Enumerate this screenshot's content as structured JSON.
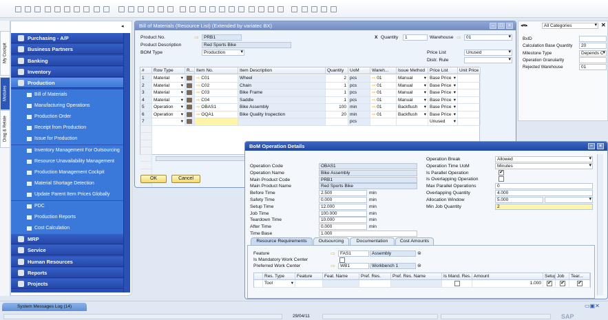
{
  "toolbar": {
    "icons": [
      "new-document",
      "print",
      "print-preview",
      "export-word",
      "export-pdf",
      "export-excel",
      "send-email",
      "send-sms",
      "launch",
      "lock",
      "find",
      "first-record",
      "previous-record",
      "next-record",
      "last-record",
      "last",
      "filter",
      "sort",
      "base-document",
      "target-document",
      "gross-profit",
      "payment-means",
      "journal",
      "template",
      "edit-layout",
      "form-settings",
      "query",
      "alerts",
      "calendar",
      "help",
      "window-tile",
      "window-cascade"
    ]
  },
  "side_tabs": [
    "My Cockpit",
    "Modules",
    "Drag & Relate"
  ],
  "modules": {
    "collapse": "◂",
    "before": [
      {
        "label": "Purchasing - A/P",
        "icon": "cart-icon"
      },
      {
        "label": "Business Partners",
        "icon": "partners-icon"
      },
      {
        "label": "Banking",
        "icon": "banking-icon"
      },
      {
        "label": "Inventory",
        "icon": "inventory-icon"
      }
    ],
    "active": {
      "label": "Production",
      "icon": "gear-icon"
    },
    "sub": [
      {
        "label": "Bill of Materials",
        "icon": "form-icon"
      },
      {
        "label": "Manufacturing Operations",
        "icon": "form-icon"
      },
      {
        "label": "Production Order",
        "icon": "form-icon"
      },
      {
        "label": "Receipt from Production",
        "icon": "form-icon"
      },
      {
        "label": "Issue for Production",
        "icon": "form-icon"
      },
      {
        "label": "Inventory Management For Outsourcing",
        "icon": "form-icon"
      },
      {
        "label": "Resource Unavailability Management",
        "icon": "form-icon"
      },
      {
        "label": "Production Management Cockpit",
        "icon": "form-icon"
      },
      {
        "label": "Material Shortage Detection",
        "icon": "form-icon"
      },
      {
        "label": "Update Parent Item Prices Globally",
        "icon": "form-icon"
      },
      {
        "label": "PDC",
        "icon": "folder-icon"
      },
      {
        "label": "Production Reports",
        "icon": "folder-icon"
      },
      {
        "label": "Cost Calculation",
        "icon": "folder-icon"
      }
    ],
    "after": [
      {
        "label": "MRP",
        "icon": "mrp-icon"
      },
      {
        "label": "Service",
        "icon": "wrench-icon"
      },
      {
        "label": "Human Resources",
        "icon": "people-icon"
      },
      {
        "label": "Reports",
        "icon": "reports-icon"
      },
      {
        "label": "Projects",
        "icon": "projects-icon"
      }
    ]
  },
  "bom": {
    "title": "Bill of Materials (Resource List) (Extended by variatec BX)",
    "product_no_label": "Product No.",
    "product_no": "PRB1",
    "product_desc_label": "Product Description",
    "product_desc": "Red Sports Bike",
    "bom_type_label": "BOM Type",
    "bom_type": "Production",
    "x_label": "X",
    "quantity_label": "Quantity",
    "quantity": "1",
    "warehouse_label": "Warehouse",
    "warehouse": "01",
    "price_list_label": "Price List",
    "price_list": "Unused",
    "distr_rule_label": "Distr. Rule",
    "distr_rule": "",
    "columns": [
      "#",
      "Row Type",
      "R...",
      "Item No.",
      "Item Description",
      "Quantity",
      "UoM",
      "Wareh...",
      "Issue Method",
      "Price List",
      "Unit Price"
    ],
    "rows": [
      [
        "1",
        "Material",
        "",
        "C01",
        "Wheel",
        "2",
        "pcs",
        "01",
        "Manual",
        "Base Price",
        ""
      ],
      [
        "2",
        "Material",
        "",
        "C02",
        "Chain",
        "1",
        "pcs",
        "01",
        "Manual",
        "Base Price",
        ""
      ],
      [
        "3",
        "Material",
        "",
        "C03",
        "Bike Frame",
        "1",
        "pcs",
        "01",
        "Manual",
        "Base Price",
        ""
      ],
      [
        "4",
        "Material",
        "",
        "C04",
        "Saddle",
        "1",
        "pcs",
        "01",
        "Manual",
        "Base Price",
        ""
      ],
      [
        "5",
        "Operation",
        "",
        "OBAS1",
        "Bike Assembly",
        "100",
        "min",
        "01",
        "Backflush",
        "Base Price",
        ""
      ],
      [
        "6",
        "Operation",
        "",
        "OQA1",
        "Bike Quality Inspection",
        "20",
        "min",
        "01",
        "Backflush",
        "Base Price",
        ""
      ],
      [
        "7",
        "",
        "",
        "",
        "",
        "",
        "pcs",
        "",
        "",
        "Unused",
        ""
      ]
    ],
    "ok": "OK",
    "cancel": "Cancel"
  },
  "udf": {
    "category": "All Categories",
    "fields": [
      {
        "label": "BxID",
        "value": ""
      },
      {
        "label": "Calculation Base Quantity",
        "value": "20"
      },
      {
        "label": "Milestone Type",
        "value": "Depends C"
      },
      {
        "label": "Operation Granularity",
        "value": ""
      },
      {
        "label": "Rejected Warehouse",
        "value": "01"
      }
    ]
  },
  "op": {
    "title": "BoM Operation Details",
    "left": [
      {
        "label": "Operation Code",
        "value": "OBAS1",
        "unit": ""
      },
      {
        "label": "Operation Name",
        "value": "Bike Assembly",
        "unit": ""
      },
      {
        "label": "Main Product Code",
        "value": "PRB1",
        "unit": ""
      },
      {
        "label": "Main Product Name",
        "value": "Red Sports Bike",
        "unit": ""
      },
      {
        "label": "Before Time",
        "value": "2.500",
        "unit": "min"
      },
      {
        "label": "Safety Time",
        "value": "0.000",
        "unit": "min"
      },
      {
        "label": "Setup Time",
        "value": "12.000",
        "unit": "min"
      },
      {
        "label": "Job Time",
        "value": "100.000",
        "unit": "min"
      },
      {
        "label": "Teardown Time",
        "value": "10.000",
        "unit": "min"
      },
      {
        "label": "After Time",
        "value": "0.000",
        "unit": "min"
      },
      {
        "label": "Time Base",
        "value": "1.000",
        "unit": ""
      }
    ],
    "right": [
      {
        "label": "Operation Break",
        "value": "Allowed",
        "type": "select"
      },
      {
        "label": "Operation Time UoM",
        "value": "Minutes",
        "type": "select"
      },
      {
        "label": "Is Parallel Operation",
        "value": "✔",
        "type": "check"
      },
      {
        "label": "Is Overlapping Operation",
        "value": "",
        "type": "check"
      },
      {
        "label": "Max Parallel Operations",
        "value": "0",
        "type": "text"
      },
      {
        "label": "Overlapping Quantity",
        "value": "4.000",
        "type": "text"
      },
      {
        "label": "Allocation Window",
        "value": "5.000",
        "type": "split"
      },
      {
        "label": "Min Job Quantity",
        "value": "2",
        "type": "active"
      }
    ],
    "tabs": [
      "Resource Requirements",
      "Outsourcing",
      "Documentation",
      "Cost Amounts"
    ],
    "feature_label": "Feature",
    "feature_code": "FAS1",
    "feature_name": "Assembly",
    "mandatory_wc_label": "Is Mandatory Work Center",
    "pref_wc_label": "Preferred Work Center",
    "pref_wc_code": "WB1",
    "pref_wc_name": "Workbench 1",
    "columns": [
      "",
      "Res. Type",
      "Feature",
      "Feat. Name",
      "Pref. Res.",
      "Pref. Res. Name",
      "Is Mand. Res.",
      "Amount",
      "Setup",
      "Job",
      "Tear..."
    ],
    "row": [
      "",
      "Tool",
      "",
      "",
      "",
      "",
      "",
      "1.000",
      "✔",
      "✔",
      "✔"
    ]
  },
  "bottom": {
    "log_tab": "System Messages Log (14)",
    "date": "29/04/11",
    "brand": "SAP"
  }
}
